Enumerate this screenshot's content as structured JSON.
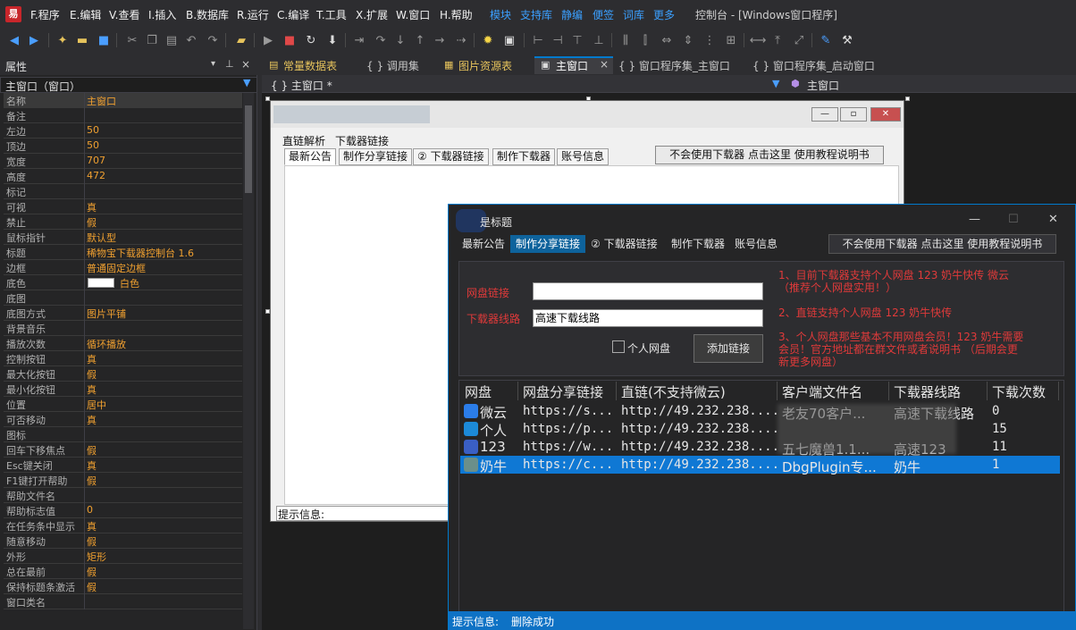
{
  "menu": {
    "items": [
      "F.程序",
      "E.编辑",
      "V.查看",
      "I.插入",
      "B.数据库",
      "R.运行",
      "C.编译",
      "T.工具",
      "X.扩展",
      "W.窗口",
      "H.帮助"
    ],
    "links": [
      "模块",
      "支持库",
      "静编",
      "便签",
      "词库",
      "更多"
    ],
    "window_title": "控制台 - [Windows窗口程序]"
  },
  "properties": {
    "title": "属性",
    "selected": "主窗口（窗口）",
    "rows": [
      {
        "name": "名称",
        "value": "主窗口"
      },
      {
        "name": "备注",
        "value": ""
      },
      {
        "name": "左边",
        "value": "50"
      },
      {
        "name": "顶边",
        "value": "50"
      },
      {
        "name": "宽度",
        "value": "707"
      },
      {
        "name": "高度",
        "value": "472"
      },
      {
        "name": "标记",
        "value": ""
      },
      {
        "name": "可视",
        "value": "真"
      },
      {
        "name": "禁止",
        "value": "假"
      },
      {
        "name": "鼠标指针",
        "value": "默认型"
      },
      {
        "name": "标题",
        "value": "稀物宝下载器控制台  1.6"
      },
      {
        "name": "边框",
        "value": "普通固定边框"
      },
      {
        "name": "底色",
        "value": "白色"
      },
      {
        "name": "底图",
        "value": ""
      },
      {
        "name": "  底图方式",
        "value": "图片平铺"
      },
      {
        "name": "背景音乐",
        "value": ""
      },
      {
        "name": "  播放次数",
        "value": "循环播放"
      },
      {
        "name": "控制按钮",
        "value": "真"
      },
      {
        "name": "  最大化按钮",
        "value": "假"
      },
      {
        "name": "  最小化按钮",
        "value": "真"
      },
      {
        "name": "位置",
        "value": "居中"
      },
      {
        "name": "可否移动",
        "value": "真"
      },
      {
        "name": "图标",
        "value": ""
      },
      {
        "name": "回车下移焦点",
        "value": "假"
      },
      {
        "name": "Esc键关闭",
        "value": "真"
      },
      {
        "name": "F1键打开帮助",
        "value": "假"
      },
      {
        "name": "  帮助文件名",
        "value": ""
      },
      {
        "name": "  帮助标志值",
        "value": "0"
      },
      {
        "name": "在任务条中显示",
        "value": "真"
      },
      {
        "name": "随意移动",
        "value": "假"
      },
      {
        "name": "外形",
        "value": "矩形"
      },
      {
        "name": "总在最前",
        "value": "假"
      },
      {
        "name": "保持标题条激活",
        "value": "假"
      },
      {
        "name": "窗口类名",
        "value": ""
      }
    ]
  },
  "editor_tabs": [
    "常量数据表",
    "{ } 调用集",
    "图片资源表",
    "主窗口",
    "{ } 窗口程序集_主窗口",
    "{ } 窗口程序集_启动窗口"
  ],
  "editor_bar": {
    "left": "{ } 主窗口 *",
    "right": "主窗口"
  },
  "designer": {
    "menu": [
      "直链解析",
      "下载器链接"
    ],
    "tabs": [
      "最新公告",
      "制作分享链接",
      "② 下载器链接",
      "制作下载器",
      "账号信息"
    ],
    "top_button": "不会使用下载器 点击这里 使用教程说明书",
    "status_label": "提示信息:"
  },
  "app": {
    "title": "是标题",
    "tabs": [
      "最新公告",
      "制作分享链接",
      "② 下载器链接",
      "制作下载器",
      "账号信息"
    ],
    "active_tab": "制作分享链接",
    "top_button": "不会使用下载器 点击这里 使用教程说明书",
    "form": {
      "disk_link_label": "网盘链接",
      "disk_link_value": "",
      "line_label": "下载器线路",
      "line_value": "高速下载线路",
      "checkbox_label": "个人网盘",
      "add_button": "添加链接"
    },
    "notes": [
      "1、目前下载器支持个人网盘 123 奶牛快传 微云",
      "（推荐个人网盘实用！）",
      "2、直链支持个人网盘 123 奶牛快传",
      "3、个人网盘那些基本不用网盘会员！123 奶牛需要",
      "会员！官方地址都在群文件或者说明书 （后期会更",
      "新更多网盘）"
    ],
    "list": {
      "columns": [
        "网盘",
        "网盘分享链接",
        "直链(不支持微云)",
        "客户端文件名",
        "下载器线路",
        "下载次数"
      ],
      "rows": [
        {
          "disk": "微云",
          "share": "https://s...",
          "direct": "http://49.232.238....",
          "file": "老友70客户...",
          "line": "高速下载线路",
          "count": "0",
          "icon_color": "#2b7de9"
        },
        {
          "disk": "个人",
          "share": "https://p...",
          "direct": "http://49.232.238....",
          "file": "",
          "line": "",
          "count": "15",
          "icon_color": "#1c8ad8"
        },
        {
          "disk": "123",
          "share": "https://w...",
          "direct": "http://49.232.238....",
          "file": "五七魔兽1.1...",
          "line": "高速123",
          "count": "11",
          "icon_color": "#3a5fc4"
        },
        {
          "disk": "奶牛",
          "share": "https://c...",
          "direct": "http://49.232.238....",
          "file": "DbgPlugin专...",
          "line": "奶牛",
          "count": "1",
          "icon_color": "#6b8f8a"
        }
      ],
      "selected_index": 3
    },
    "status_label": "提示信息:",
    "status_value": "删除成功"
  },
  "colors": {
    "accent": "#007acc",
    "warning_text": "#e03a3a",
    "property_value": "#f0a030"
  }
}
